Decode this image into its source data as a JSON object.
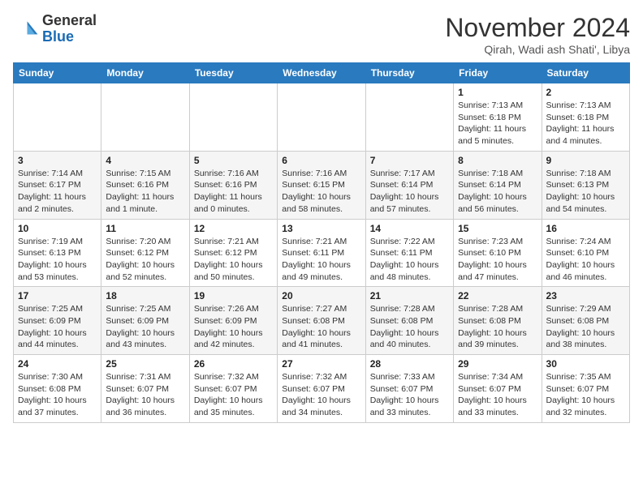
{
  "header": {
    "logo_line1": "General",
    "logo_line2": "Blue",
    "month_title": "November 2024",
    "location": "Qirah, Wadi ash Shati', Libya"
  },
  "days_of_week": [
    "Sunday",
    "Monday",
    "Tuesday",
    "Wednesday",
    "Thursday",
    "Friday",
    "Saturday"
  ],
  "weeks": [
    [
      {
        "day": "",
        "info": ""
      },
      {
        "day": "",
        "info": ""
      },
      {
        "day": "",
        "info": ""
      },
      {
        "day": "",
        "info": ""
      },
      {
        "day": "",
        "info": ""
      },
      {
        "day": "1",
        "info": "Sunrise: 7:13 AM\nSunset: 6:18 PM\nDaylight: 11 hours and 5 minutes."
      },
      {
        "day": "2",
        "info": "Sunrise: 7:13 AM\nSunset: 6:18 PM\nDaylight: 11 hours and 4 minutes."
      }
    ],
    [
      {
        "day": "3",
        "info": "Sunrise: 7:14 AM\nSunset: 6:17 PM\nDaylight: 11 hours and 2 minutes."
      },
      {
        "day": "4",
        "info": "Sunrise: 7:15 AM\nSunset: 6:16 PM\nDaylight: 11 hours and 1 minute."
      },
      {
        "day": "5",
        "info": "Sunrise: 7:16 AM\nSunset: 6:16 PM\nDaylight: 11 hours and 0 minutes."
      },
      {
        "day": "6",
        "info": "Sunrise: 7:16 AM\nSunset: 6:15 PM\nDaylight: 10 hours and 58 minutes."
      },
      {
        "day": "7",
        "info": "Sunrise: 7:17 AM\nSunset: 6:14 PM\nDaylight: 10 hours and 57 minutes."
      },
      {
        "day": "8",
        "info": "Sunrise: 7:18 AM\nSunset: 6:14 PM\nDaylight: 10 hours and 56 minutes."
      },
      {
        "day": "9",
        "info": "Sunrise: 7:18 AM\nSunset: 6:13 PM\nDaylight: 10 hours and 54 minutes."
      }
    ],
    [
      {
        "day": "10",
        "info": "Sunrise: 7:19 AM\nSunset: 6:13 PM\nDaylight: 10 hours and 53 minutes."
      },
      {
        "day": "11",
        "info": "Sunrise: 7:20 AM\nSunset: 6:12 PM\nDaylight: 10 hours and 52 minutes."
      },
      {
        "day": "12",
        "info": "Sunrise: 7:21 AM\nSunset: 6:12 PM\nDaylight: 10 hours and 50 minutes."
      },
      {
        "day": "13",
        "info": "Sunrise: 7:21 AM\nSunset: 6:11 PM\nDaylight: 10 hours and 49 minutes."
      },
      {
        "day": "14",
        "info": "Sunrise: 7:22 AM\nSunset: 6:11 PM\nDaylight: 10 hours and 48 minutes."
      },
      {
        "day": "15",
        "info": "Sunrise: 7:23 AM\nSunset: 6:10 PM\nDaylight: 10 hours and 47 minutes."
      },
      {
        "day": "16",
        "info": "Sunrise: 7:24 AM\nSunset: 6:10 PM\nDaylight: 10 hours and 46 minutes."
      }
    ],
    [
      {
        "day": "17",
        "info": "Sunrise: 7:25 AM\nSunset: 6:09 PM\nDaylight: 10 hours and 44 minutes."
      },
      {
        "day": "18",
        "info": "Sunrise: 7:25 AM\nSunset: 6:09 PM\nDaylight: 10 hours and 43 minutes."
      },
      {
        "day": "19",
        "info": "Sunrise: 7:26 AM\nSunset: 6:09 PM\nDaylight: 10 hours and 42 minutes."
      },
      {
        "day": "20",
        "info": "Sunrise: 7:27 AM\nSunset: 6:08 PM\nDaylight: 10 hours and 41 minutes."
      },
      {
        "day": "21",
        "info": "Sunrise: 7:28 AM\nSunset: 6:08 PM\nDaylight: 10 hours and 40 minutes."
      },
      {
        "day": "22",
        "info": "Sunrise: 7:28 AM\nSunset: 6:08 PM\nDaylight: 10 hours and 39 minutes."
      },
      {
        "day": "23",
        "info": "Sunrise: 7:29 AM\nSunset: 6:08 PM\nDaylight: 10 hours and 38 minutes."
      }
    ],
    [
      {
        "day": "24",
        "info": "Sunrise: 7:30 AM\nSunset: 6:08 PM\nDaylight: 10 hours and 37 minutes."
      },
      {
        "day": "25",
        "info": "Sunrise: 7:31 AM\nSunset: 6:07 PM\nDaylight: 10 hours and 36 minutes."
      },
      {
        "day": "26",
        "info": "Sunrise: 7:32 AM\nSunset: 6:07 PM\nDaylight: 10 hours and 35 minutes."
      },
      {
        "day": "27",
        "info": "Sunrise: 7:32 AM\nSunset: 6:07 PM\nDaylight: 10 hours and 34 minutes."
      },
      {
        "day": "28",
        "info": "Sunrise: 7:33 AM\nSunset: 6:07 PM\nDaylight: 10 hours and 33 minutes."
      },
      {
        "day": "29",
        "info": "Sunrise: 7:34 AM\nSunset: 6:07 PM\nDaylight: 10 hours and 33 minutes."
      },
      {
        "day": "30",
        "info": "Sunrise: 7:35 AM\nSunset: 6:07 PM\nDaylight: 10 hours and 32 minutes."
      }
    ]
  ]
}
